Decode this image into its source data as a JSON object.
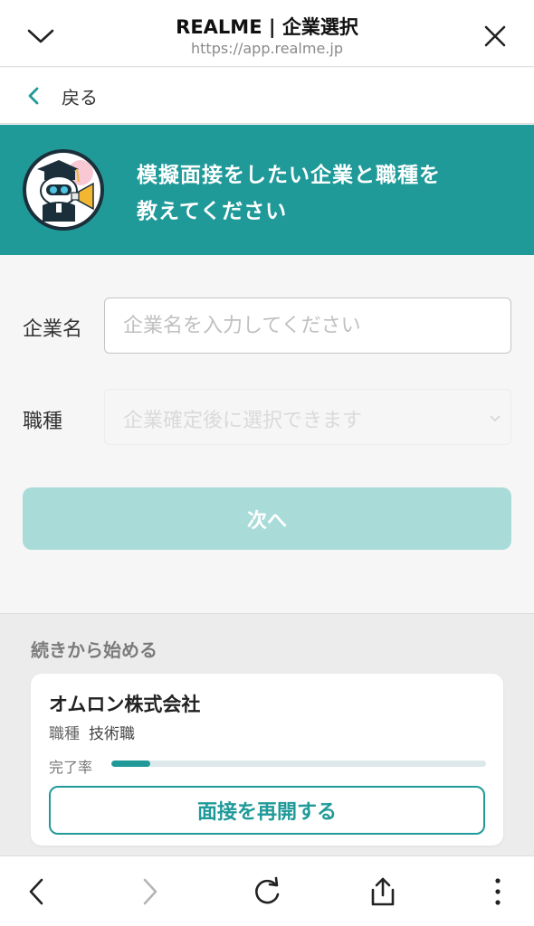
{
  "browser": {
    "title": "REALME | 企業選択",
    "url": "https://app.realme.jp"
  },
  "nav": {
    "back_label": "戻る"
  },
  "banner": {
    "line1": "模擬面接をしたい企業と職種を",
    "line2": "教えてください"
  },
  "form": {
    "company_label": "企業名",
    "company_placeholder": "企業名を入力してください",
    "company_value": "",
    "job_label": "職種",
    "job_placeholder": "企業確定後に選択できます",
    "next_label": "次へ"
  },
  "continue_section": {
    "heading": "続きから始める",
    "card": {
      "company": "オムロン株式会社",
      "job_key": "職種",
      "job_value": "技術職",
      "progress_label": "完了率",
      "progress": 0.105,
      "resume_label": "面接を再開する"
    }
  },
  "colors": {
    "primary": "#209a99",
    "button_disabled": "#a9dcd9"
  },
  "icons": {
    "top_left": "chevron-down-icon",
    "top_right": "close-icon",
    "back": "chevron-left-icon",
    "toolbar": [
      "arrow-left-icon",
      "arrow-right-icon",
      "reload-icon",
      "share-icon",
      "more-vertical-icon"
    ]
  }
}
